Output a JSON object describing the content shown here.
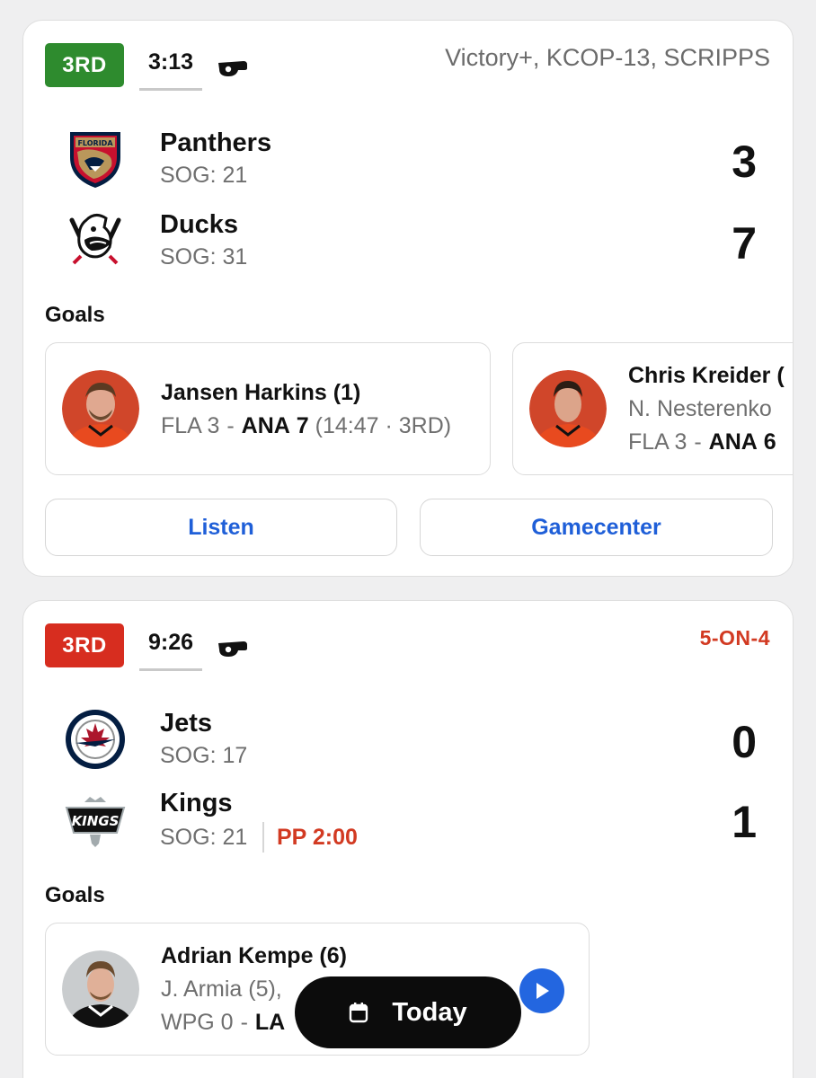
{
  "games": [
    {
      "period": "3RD",
      "clock": "3:13",
      "broadcast": "Victory+, KCOP-13, SCRIPPS",
      "teams": [
        {
          "name": "Panthers",
          "sog": "SOG: 21",
          "score": "3",
          "logo": "panthers-logo"
        },
        {
          "name": "Ducks",
          "sog": "SOG: 31",
          "score": "7",
          "logo": "ducks-logo"
        }
      ],
      "goals_title": "Goals",
      "goals": [
        {
          "scorer": "Jansen Harkins (1)",
          "away_abbr": "FLA",
          "away_score": "3",
          "dash": "-",
          "home_abbr": "ANA",
          "home_score": "7",
          "time": "(14:47 · 3RD)"
        },
        {
          "scorer": "Chris Kreider (",
          "assists": "N. Nesterenko",
          "away_abbr": "FLA",
          "away_score": "3",
          "dash": "-",
          "home_abbr": "ANA",
          "home_score": "6"
        }
      ],
      "buttons": {
        "listen": "Listen",
        "gamecenter": "Gamecenter"
      }
    },
    {
      "period": "3RD",
      "clock": "9:26",
      "situation": "5-ON-4",
      "teams": [
        {
          "name": "Jets",
          "sog": "SOG: 17",
          "score": "0",
          "logo": "jets-logo"
        },
        {
          "name": "Kings",
          "sog": "SOG: 21",
          "score": "1",
          "logo": "kings-logo",
          "power_play": "PP 2:00"
        }
      ],
      "goals_title": "Goals",
      "goals": [
        {
          "scorer": "Adrian Kempe (6)",
          "assists": "J. Armia (5), ",
          "away_abbr": "WPG",
          "away_score": "0",
          "dash": "-",
          "home_abbr": "LA"
        }
      ]
    }
  ],
  "kings_logo_text": "KINGS",
  "panthers_logo_text": "FLORIDA",
  "today_label": "Today",
  "colors": {
    "period_green": "#2e8b2e",
    "period_red": "#d72d1f",
    "link_blue": "#1f5fd8",
    "pp_red": "#d23a22"
  }
}
